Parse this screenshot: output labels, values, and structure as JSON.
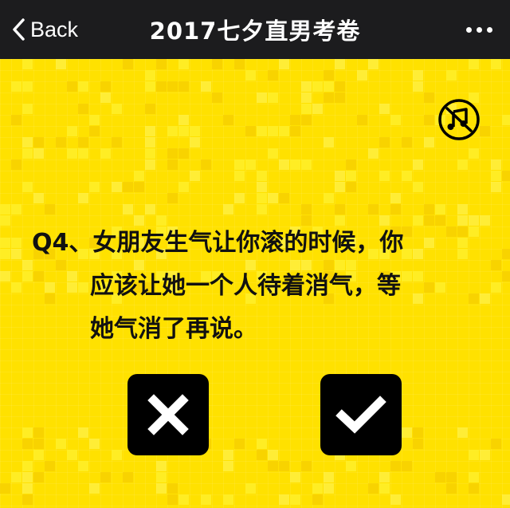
{
  "nav": {
    "back_label": "Back",
    "title": "2017七夕直男考卷"
  },
  "question": {
    "number": "Q4、",
    "line1": "女朋友生气让你滚的时候，你",
    "line2": "应该让她一个人待着消气，等",
    "line3": "她气消了再说。"
  },
  "icons": {
    "back": "chevron-left-icon",
    "more": "more-dots-icon",
    "music": "music-off-icon",
    "no": "cross-icon",
    "yes": "check-icon"
  },
  "colors": {
    "background": "#ffe100",
    "topbar": "#1c1c1e",
    "button": "#000000"
  }
}
